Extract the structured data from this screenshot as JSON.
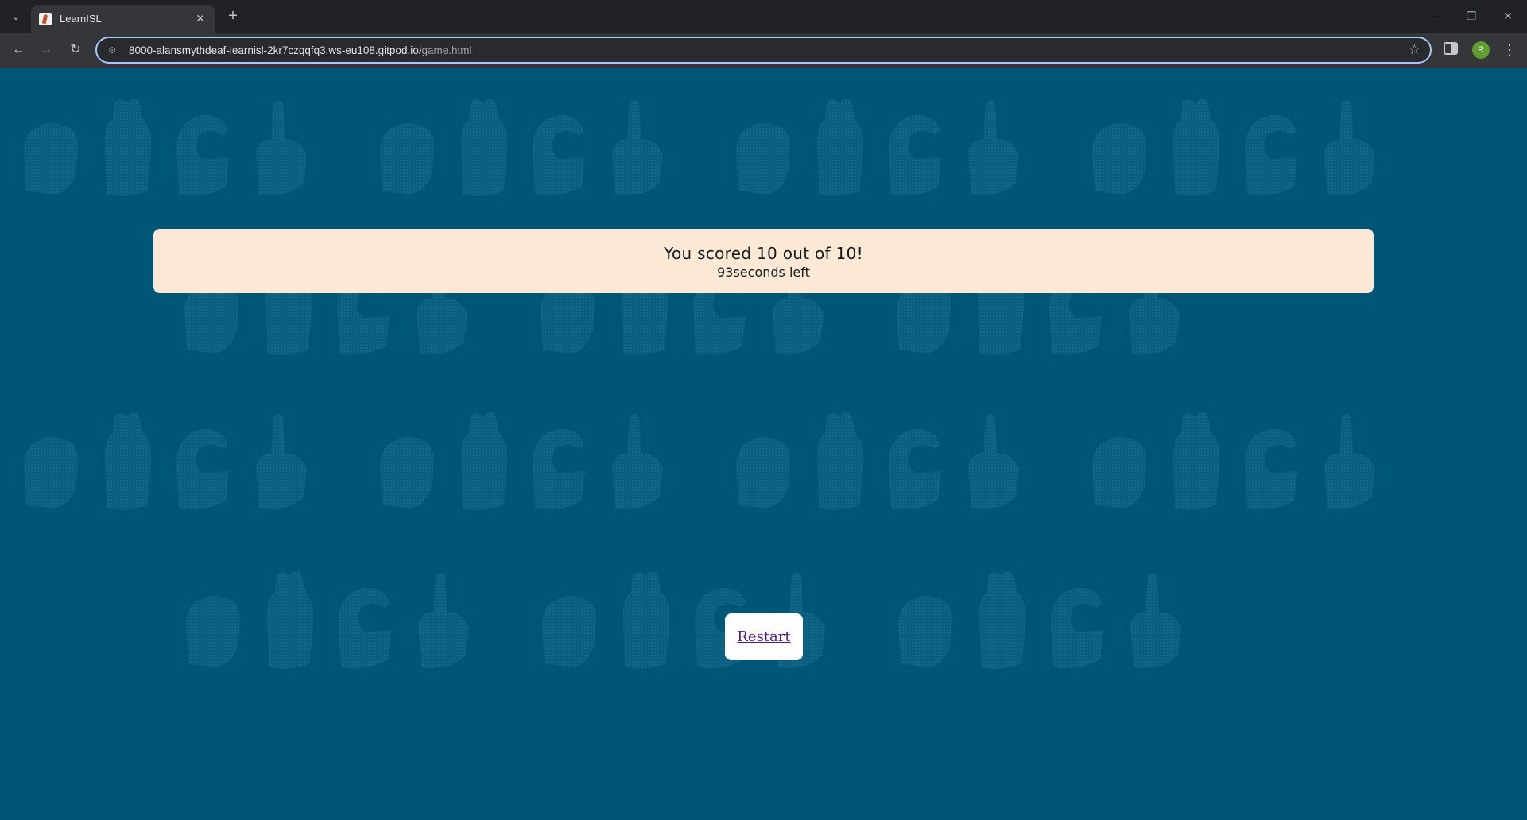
{
  "browser": {
    "tab_title": "LearnISL",
    "tab_close": "✕",
    "new_tab": "+",
    "url_host": "8000-alansmythdeaf-learnisl-2kr7czqqfq3.ws-eu108.gitpod.io",
    "url_path": "/game.html",
    "avatar_letter": "R"
  },
  "page": {
    "score_text": "You scored 10 out of 10!",
    "time_text": "93seconds left",
    "restart_label": "Restart"
  },
  "colors": {
    "page_background": "#005677",
    "score_card": "#fbe9d6",
    "restart_button": "#ffffff",
    "link": "#551a8b"
  }
}
